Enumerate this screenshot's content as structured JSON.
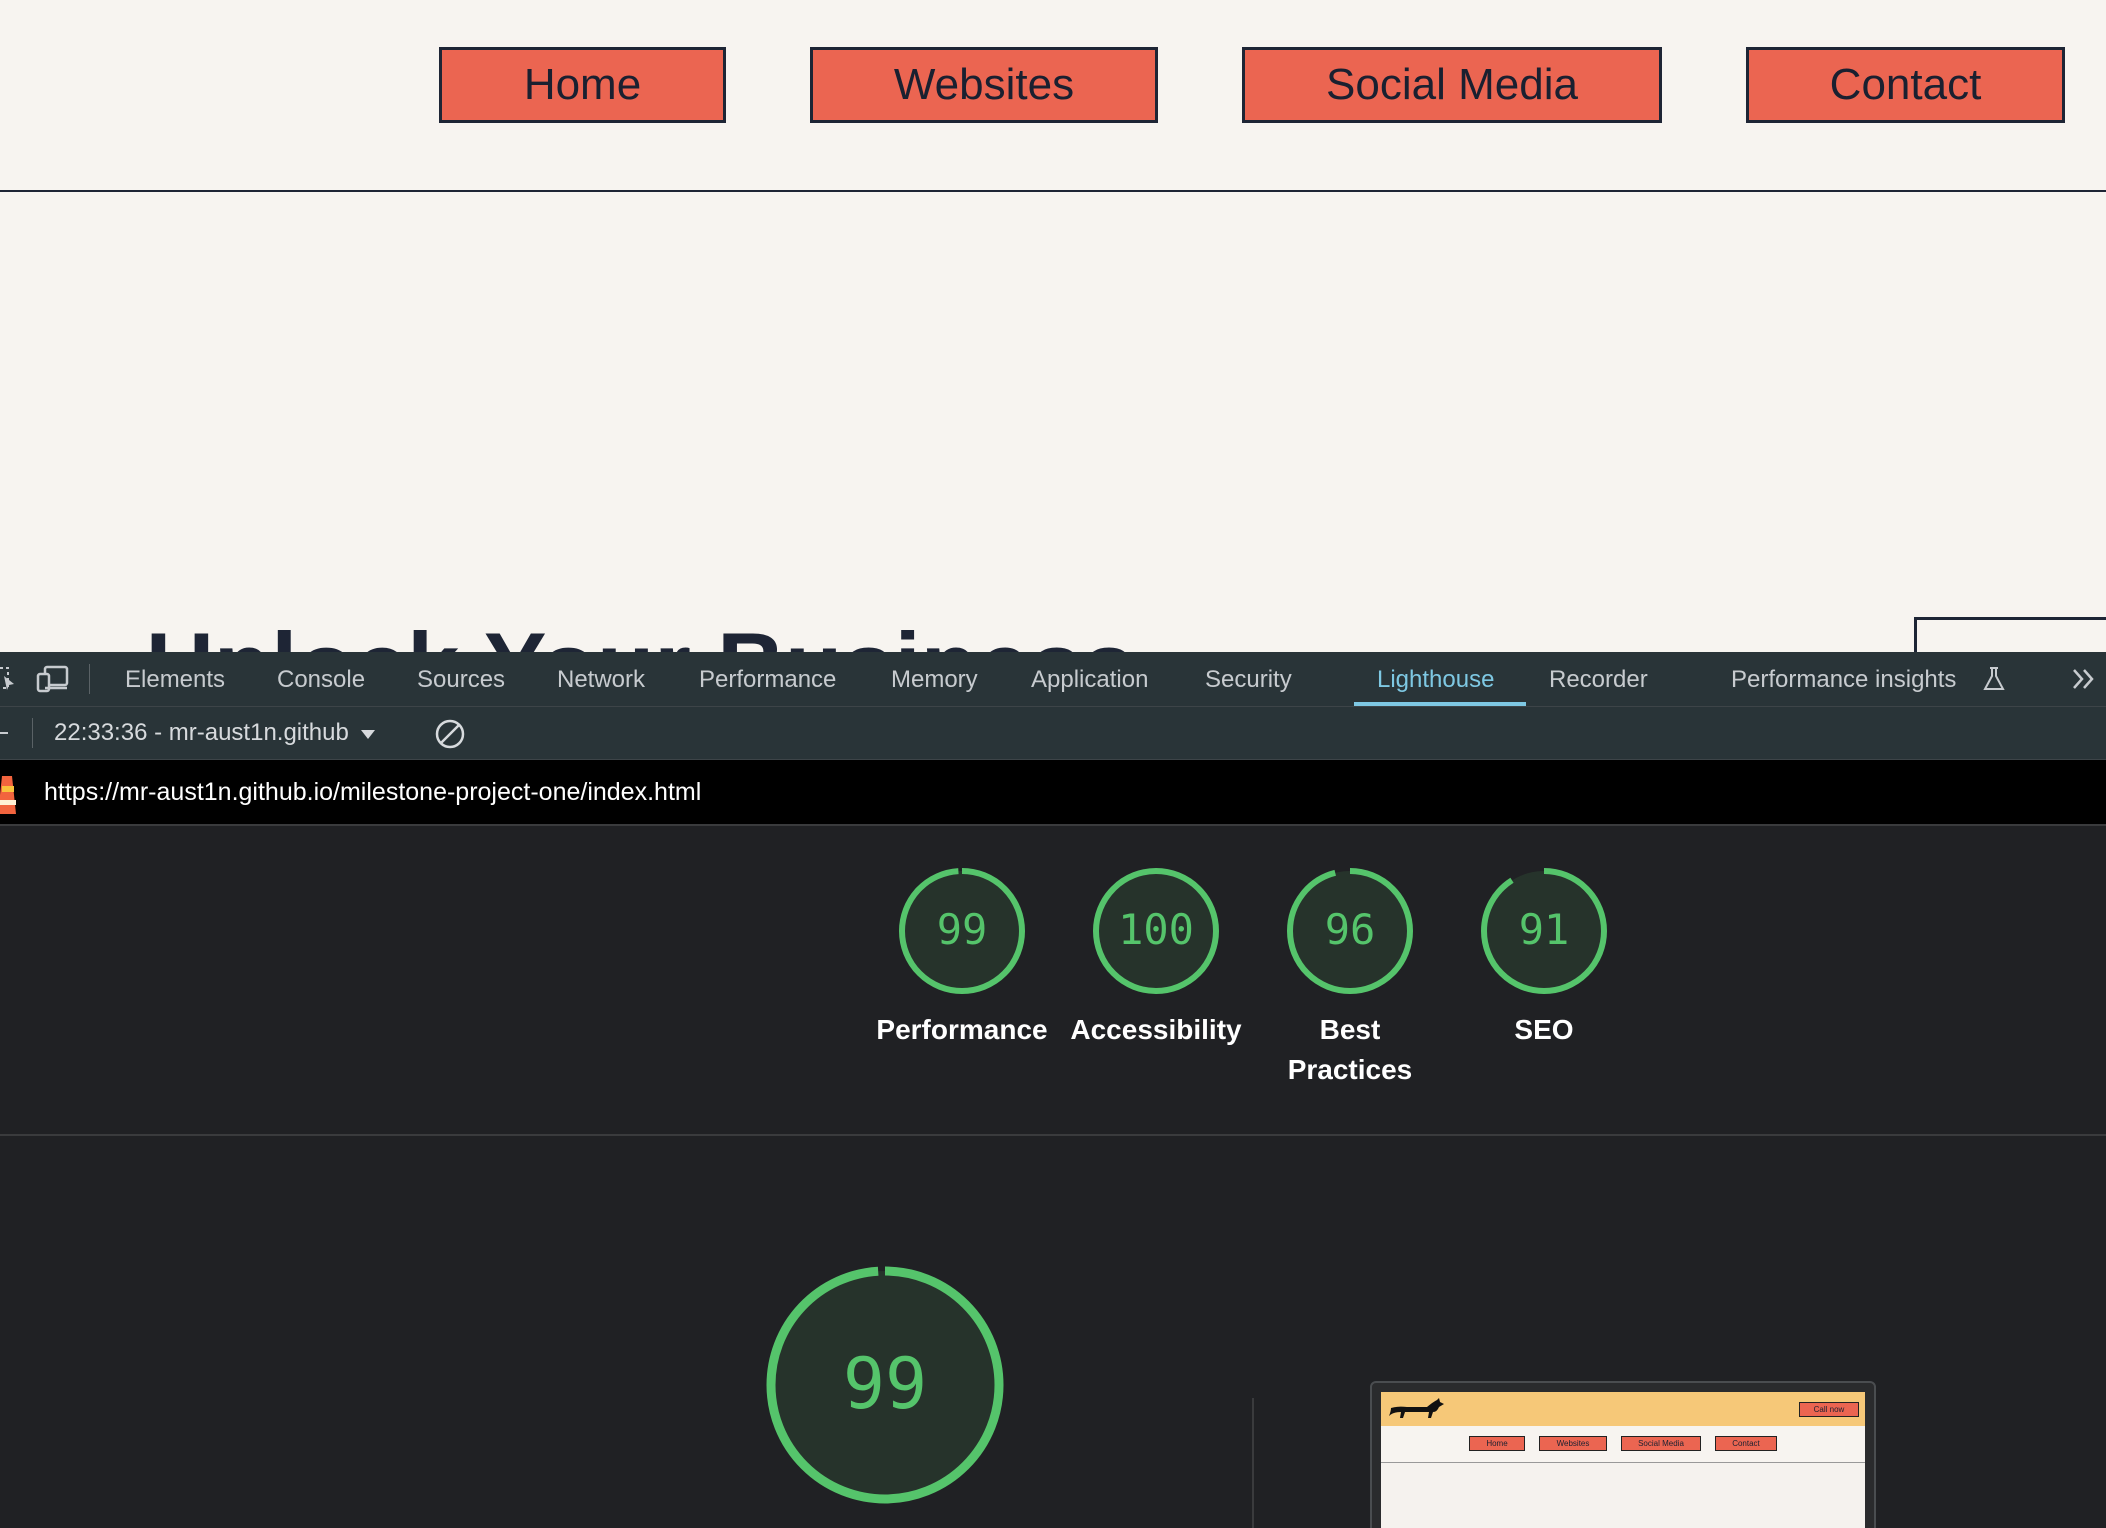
{
  "site": {
    "nav": [
      "Home",
      "Websites",
      "Social Media",
      "Contact"
    ],
    "hero_title": "Unlock Your Business"
  },
  "devtools": {
    "tabs": [
      "Elements",
      "Console",
      "Sources",
      "Network",
      "Performance",
      "Memory",
      "Application",
      "Security",
      "Lighthouse",
      "Recorder",
      "Performance insights"
    ],
    "active_tab": "Lighthouse",
    "report": "22:33:36 - mr-aust1n.github",
    "url": "https://mr-aust1n.github.io/milestone-project-one/index.html",
    "scores": [
      {
        "label": "Performance",
        "value": 99
      },
      {
        "label": "Accessibility",
        "value": 100
      },
      {
        "label": "Best Practices",
        "value": 96
      },
      {
        "label": "SEO",
        "value": 91
      }
    ],
    "main_score": {
      "value": 99
    },
    "thumbnail": {
      "cta": "Call now",
      "nav": [
        "Home",
        "Websites",
        "Social Media",
        "Contact"
      ]
    },
    "colors": {
      "pass": "#55c46b",
      "gauge_fill": "#26332b",
      "accent": "#7ec8e3"
    }
  }
}
